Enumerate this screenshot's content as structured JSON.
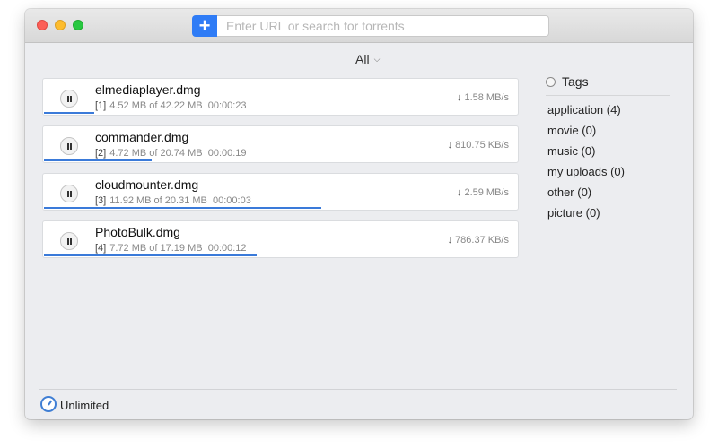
{
  "toolbar": {
    "add_label": "+",
    "search_placeholder": "Enter URL or search for torrents",
    "search_value": ""
  },
  "filter": {
    "label": "All"
  },
  "downloads": [
    {
      "name": "elmediaplayer.dmg",
      "index": "[1]",
      "progress_text": "4.52 MB of 42.22 MB",
      "time": "00:00:23",
      "speed": "1.58 MB/s",
      "progress": 0.107
    },
    {
      "name": "commander.dmg",
      "index": "[2]",
      "progress_text": "4.72 MB of 20.74 MB",
      "time": "00:00:19",
      "speed": "810.75 KB/s",
      "progress": 0.228
    },
    {
      "name": "cloudmounter.dmg",
      "index": "[3]",
      "progress_text": "11.92 MB of 20.31 MB",
      "time": "00:00:03",
      "speed": "2.59 MB/s",
      "progress": 0.587
    },
    {
      "name": "PhotoBulk.dmg",
      "index": "[4]",
      "progress_text": "7.72 MB of 17.19 MB",
      "time": "00:00:12",
      "speed": "786.37 KB/s",
      "progress": 0.449
    }
  ],
  "tags": {
    "title": "Tags",
    "items": [
      "application (4)",
      "movie (0)",
      "music (0)",
      "my uploads (0)",
      "other (0)",
      "picture (0)"
    ]
  },
  "footer": {
    "speed_limit": "Unlimited"
  },
  "colors": {
    "accent": "#2f7cf6",
    "progress": "#3a7ad9"
  }
}
